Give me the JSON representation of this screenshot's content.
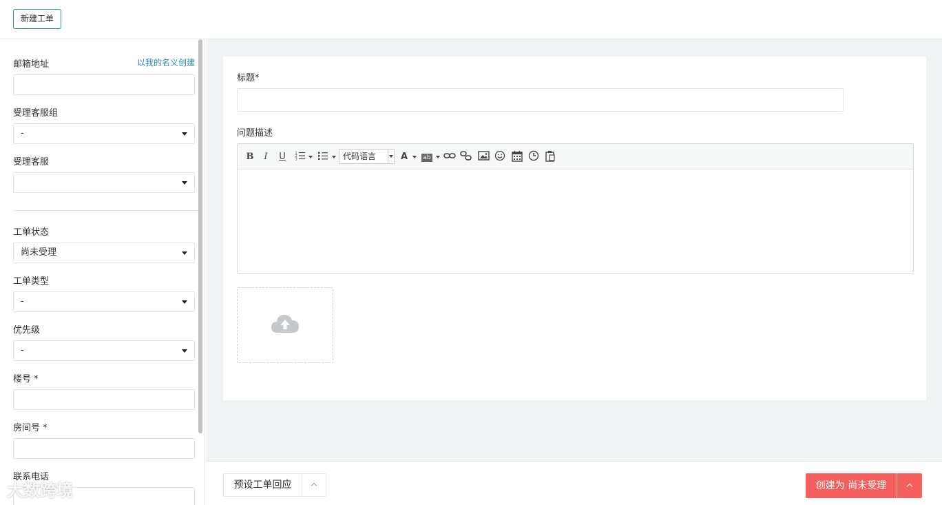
{
  "topbar": {
    "new_ticket_label": "新建工单"
  },
  "sidebar": {
    "email": {
      "label": "邮箱地址",
      "self_create_link": "以我的名义创建",
      "value": ""
    },
    "service_group": {
      "label": "受理客服组",
      "value": "-"
    },
    "agent": {
      "label": "受理客服",
      "value": ""
    },
    "ticket_status": {
      "label": "工单状态",
      "value": "尚未受理"
    },
    "ticket_type": {
      "label": "工单类型",
      "value": "-"
    },
    "priority": {
      "label": "优先级",
      "value": "-"
    },
    "building": {
      "label": "楼号 *",
      "value": ""
    },
    "room": {
      "label": "房间号 *",
      "value": ""
    },
    "phone": {
      "label": "联系电话",
      "value": ""
    }
  },
  "main": {
    "title_label": "标题*",
    "title_value": "",
    "description_label": "问题描述",
    "toolbar": {
      "bold": "B",
      "italic": "I",
      "underline": "U",
      "code_language": "代码语言",
      "font_color": "A",
      "highlight": "ab"
    }
  },
  "footer": {
    "preset_reply_label": "预设工单回应",
    "create_label": "创建为 尚未受理"
  },
  "watermark": "大数跨境",
  "colors": {
    "accent_teal": "#2d8c8c",
    "link_blue": "#2b8bb0",
    "create_red": "#f5605f",
    "background": "#f0f3f4"
  }
}
